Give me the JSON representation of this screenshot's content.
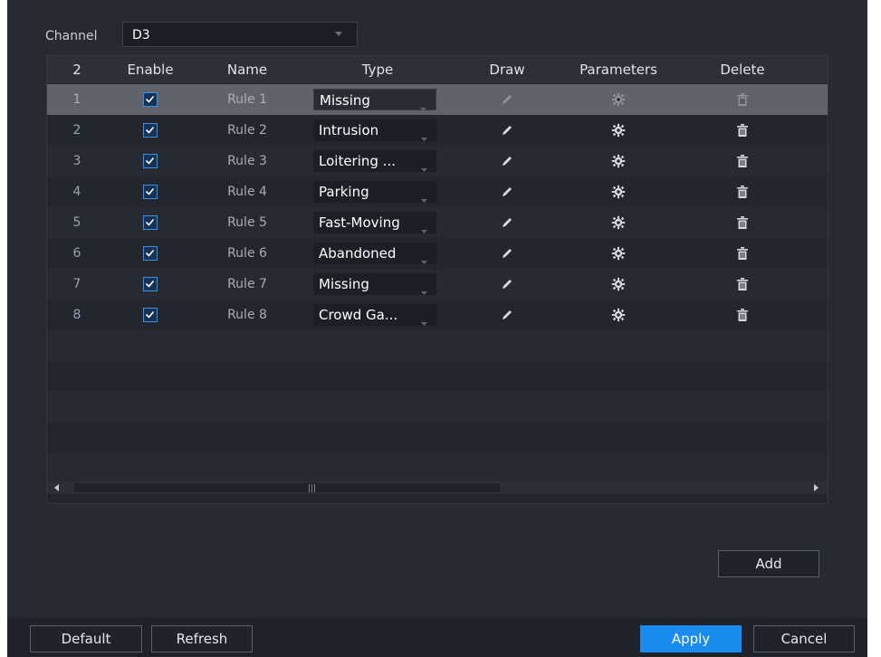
{
  "channel": {
    "label": "Channel",
    "value": "D3"
  },
  "table": {
    "headers": {
      "index": "2",
      "enable": "Enable",
      "name": "Name",
      "type": "Type",
      "draw": "Draw",
      "parameters": "Parameters",
      "delete": "Delete"
    },
    "rows": [
      {
        "index": "1",
        "enabled": true,
        "name": "Rule 1",
        "type": "Missing",
        "selected": true
      },
      {
        "index": "2",
        "enabled": true,
        "name": "Rule 2",
        "type": "Intrusion",
        "selected": false
      },
      {
        "index": "3",
        "enabled": true,
        "name": "Rule 3",
        "type": "Loitering ...",
        "selected": false
      },
      {
        "index": "4",
        "enabled": true,
        "name": "Rule 4",
        "type": "Parking",
        "selected": false
      },
      {
        "index": "5",
        "enabled": true,
        "name": "Rule 5",
        "type": "Fast-Moving",
        "selected": false
      },
      {
        "index": "6",
        "enabled": true,
        "name": "Rule 6",
        "type": "Abandoned",
        "selected": false
      },
      {
        "index": "7",
        "enabled": true,
        "name": "Rule 7",
        "type": "Missing",
        "selected": false
      },
      {
        "index": "8",
        "enabled": true,
        "name": "Rule 8",
        "type": "Crowd Ga...",
        "selected": false
      }
    ]
  },
  "buttons": {
    "add": "Add",
    "default": "Default",
    "refresh": "Refresh",
    "apply": "Apply",
    "cancel": "Cancel"
  },
  "icons": {
    "draw": "pencil-icon",
    "parameters": "gear-icon",
    "delete": "trash-icon",
    "enable": "checkbox-checked-icon"
  },
  "colors": {
    "accent": "#1a8cf0",
    "background": "#262a33",
    "selected_row": "#5f636b"
  }
}
